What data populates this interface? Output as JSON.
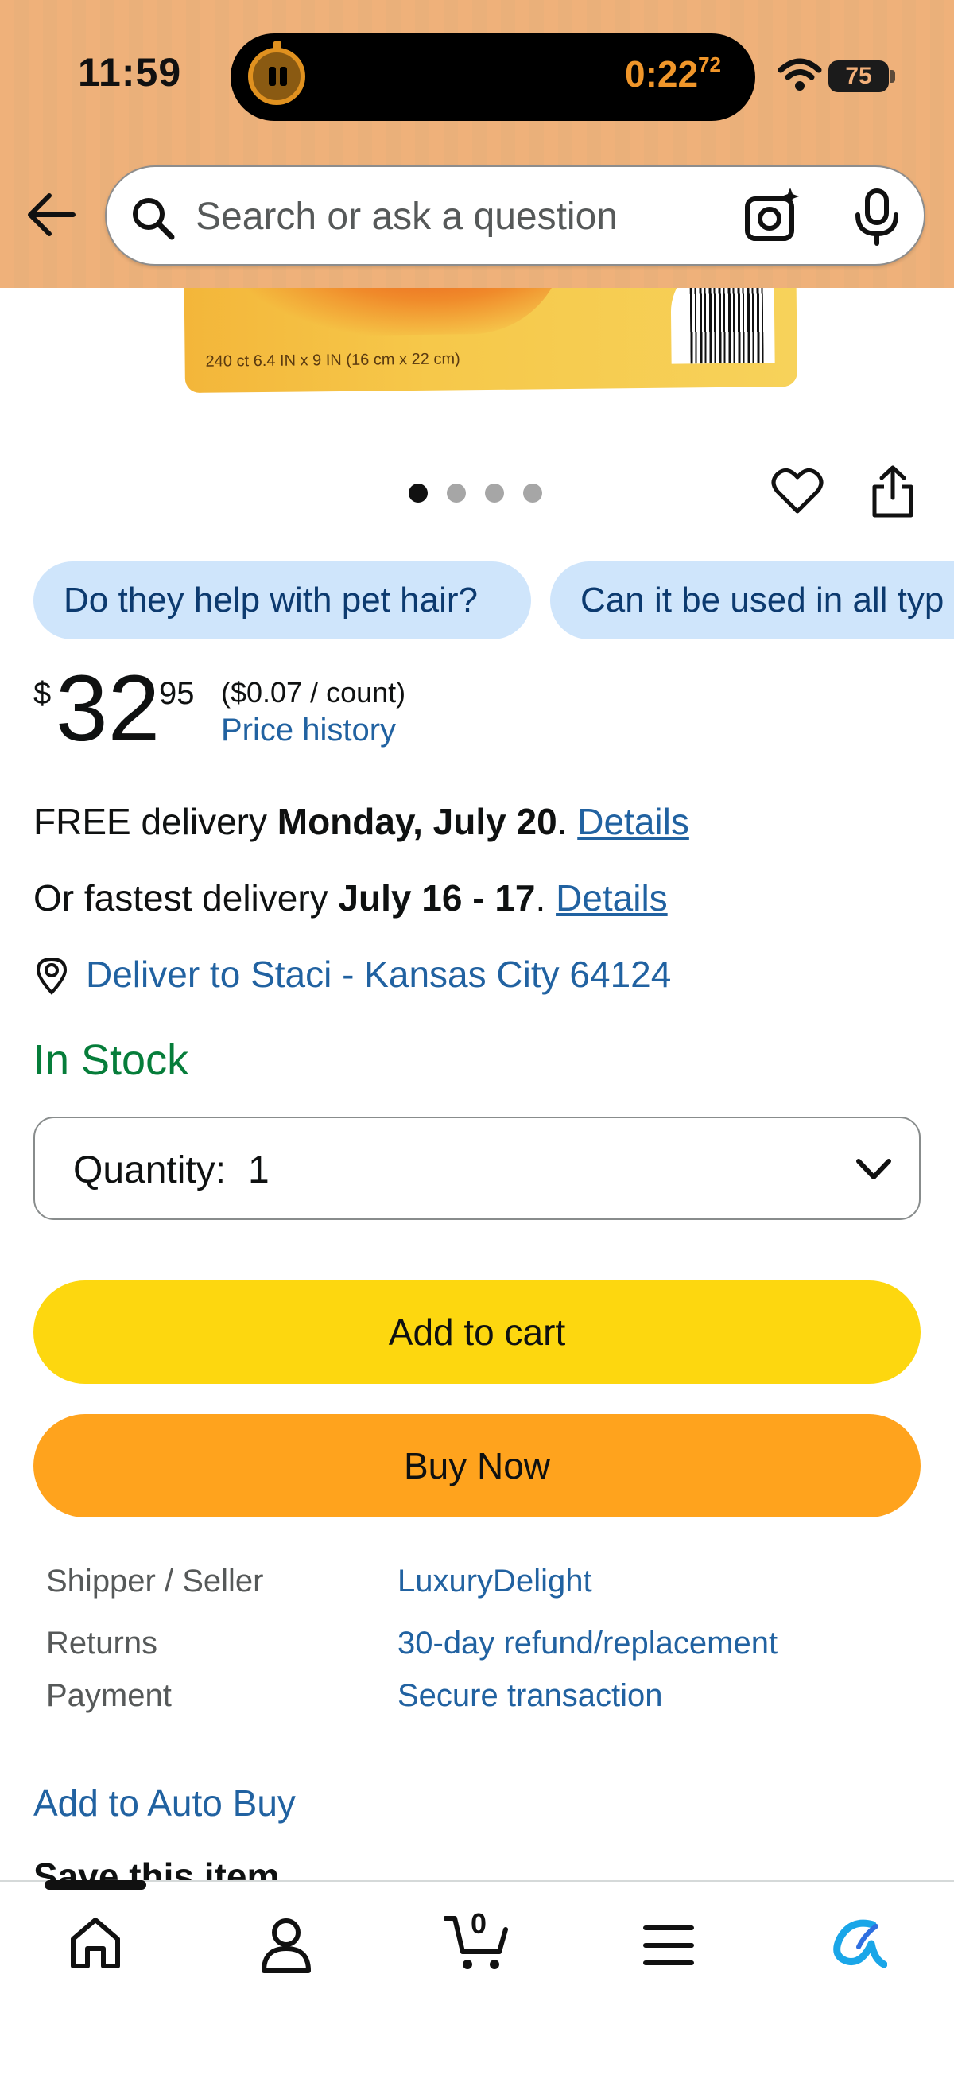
{
  "status_bar": {
    "time": "11:59",
    "timer": "0:22",
    "timer_fraction": "72",
    "battery": "75"
  },
  "search": {
    "placeholder": "Search or ask a question"
  },
  "product_image": {
    "fine_print": "240 ct 6.4 IN x 9 IN (16 cm x 22 cm)"
  },
  "carousel": {
    "count": 4,
    "active": 1
  },
  "chips": [
    {
      "label": "Do they help with pet hair?"
    },
    {
      "label": "Can it be used in all typ"
    }
  ],
  "price": {
    "symbol": "$",
    "whole": "32",
    "fraction": "95",
    "unit": "($0.07 / count)",
    "history_link": "Price history"
  },
  "delivery": {
    "free_prefix": "FREE delivery ",
    "free_date": "Monday, July 20",
    "free_suffix": ". ",
    "fast_prefix": "Or fastest delivery ",
    "fast_date": "July 16 - 17",
    "fast_suffix": ". ",
    "details_link": "Details",
    "deliver_to": "Deliver to Staci - Kansas City 64124"
  },
  "stock_status": "In Stock",
  "quantity": {
    "label": "Quantity:",
    "value": "1"
  },
  "buttons": {
    "add_to_cart": "Add to cart",
    "buy_now": "Buy Now"
  },
  "info": [
    {
      "label": "Shipper / Seller",
      "value": "LuxuryDelight"
    },
    {
      "label": "Returns",
      "value": "30-day refund/replacement"
    },
    {
      "label": "Payment",
      "value": "Secure transaction"
    }
  ],
  "auto_buy": "Add to Auto Buy",
  "save_item": "Save this item",
  "bottom_nav": {
    "cart_count": "0",
    "items": [
      "home-icon",
      "account-icon",
      "cart-icon",
      "menu-icon",
      "rufus-icon"
    ]
  },
  "colors": {
    "header_bg": "#efb17a",
    "link": "#2162a1",
    "in_stock": "#067d3a",
    "add_to_cart": "#fdd70f",
    "buy_now": "#ffa31d",
    "chip_bg": "#cfe5fb"
  }
}
